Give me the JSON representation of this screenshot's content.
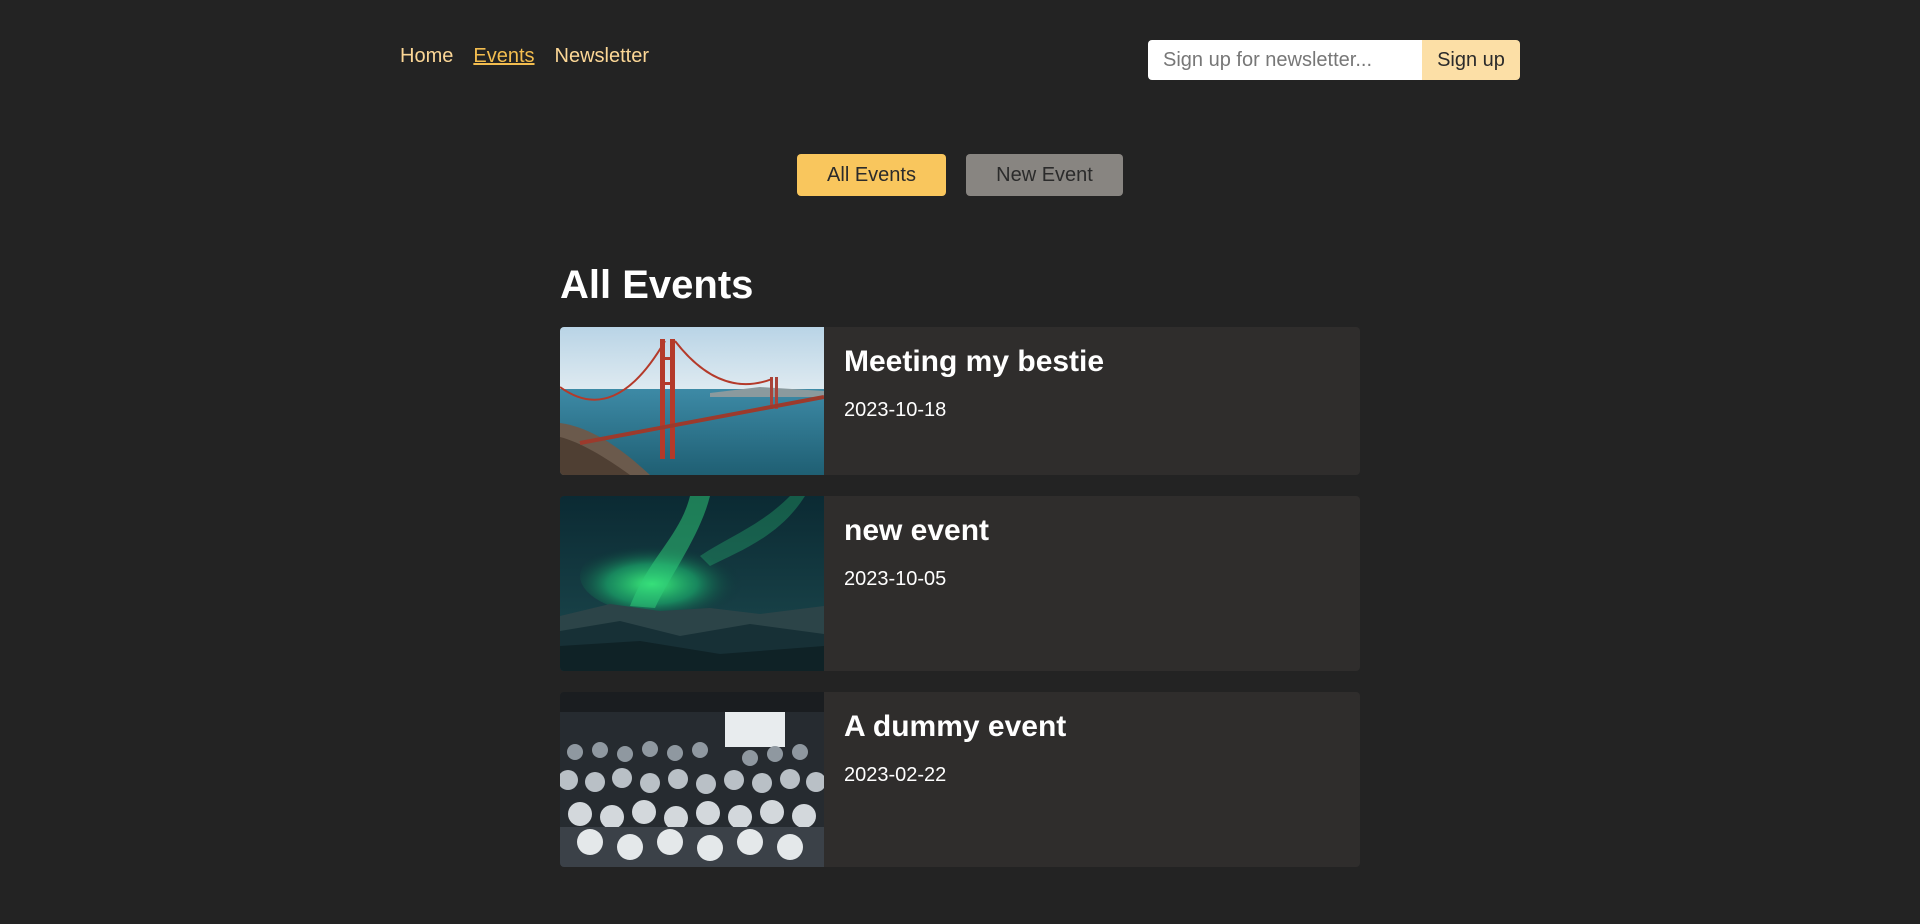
{
  "header": {
    "nav": [
      {
        "label": "Home"
      },
      {
        "label": "Events"
      },
      {
        "label": "Newsletter"
      }
    ],
    "newsletter": {
      "placeholder": "Sign up for newsletter...",
      "button_label": "Sign up"
    }
  },
  "events_nav": {
    "all_label": "All Events",
    "new_label": "New Event"
  },
  "events": {
    "heading": "All Events",
    "items": [
      {
        "title": "Meeting my bestie",
        "date": "2023-10-18"
      },
      {
        "title": "new event",
        "date": "2023-10-05"
      },
      {
        "title": "A dummy event",
        "date": "2023-02-22"
      }
    ]
  },
  "colors": {
    "background": "#232323",
    "accent": "#f9c65d",
    "nav_link": "#fcd796",
    "card": "#2f2d2c"
  }
}
